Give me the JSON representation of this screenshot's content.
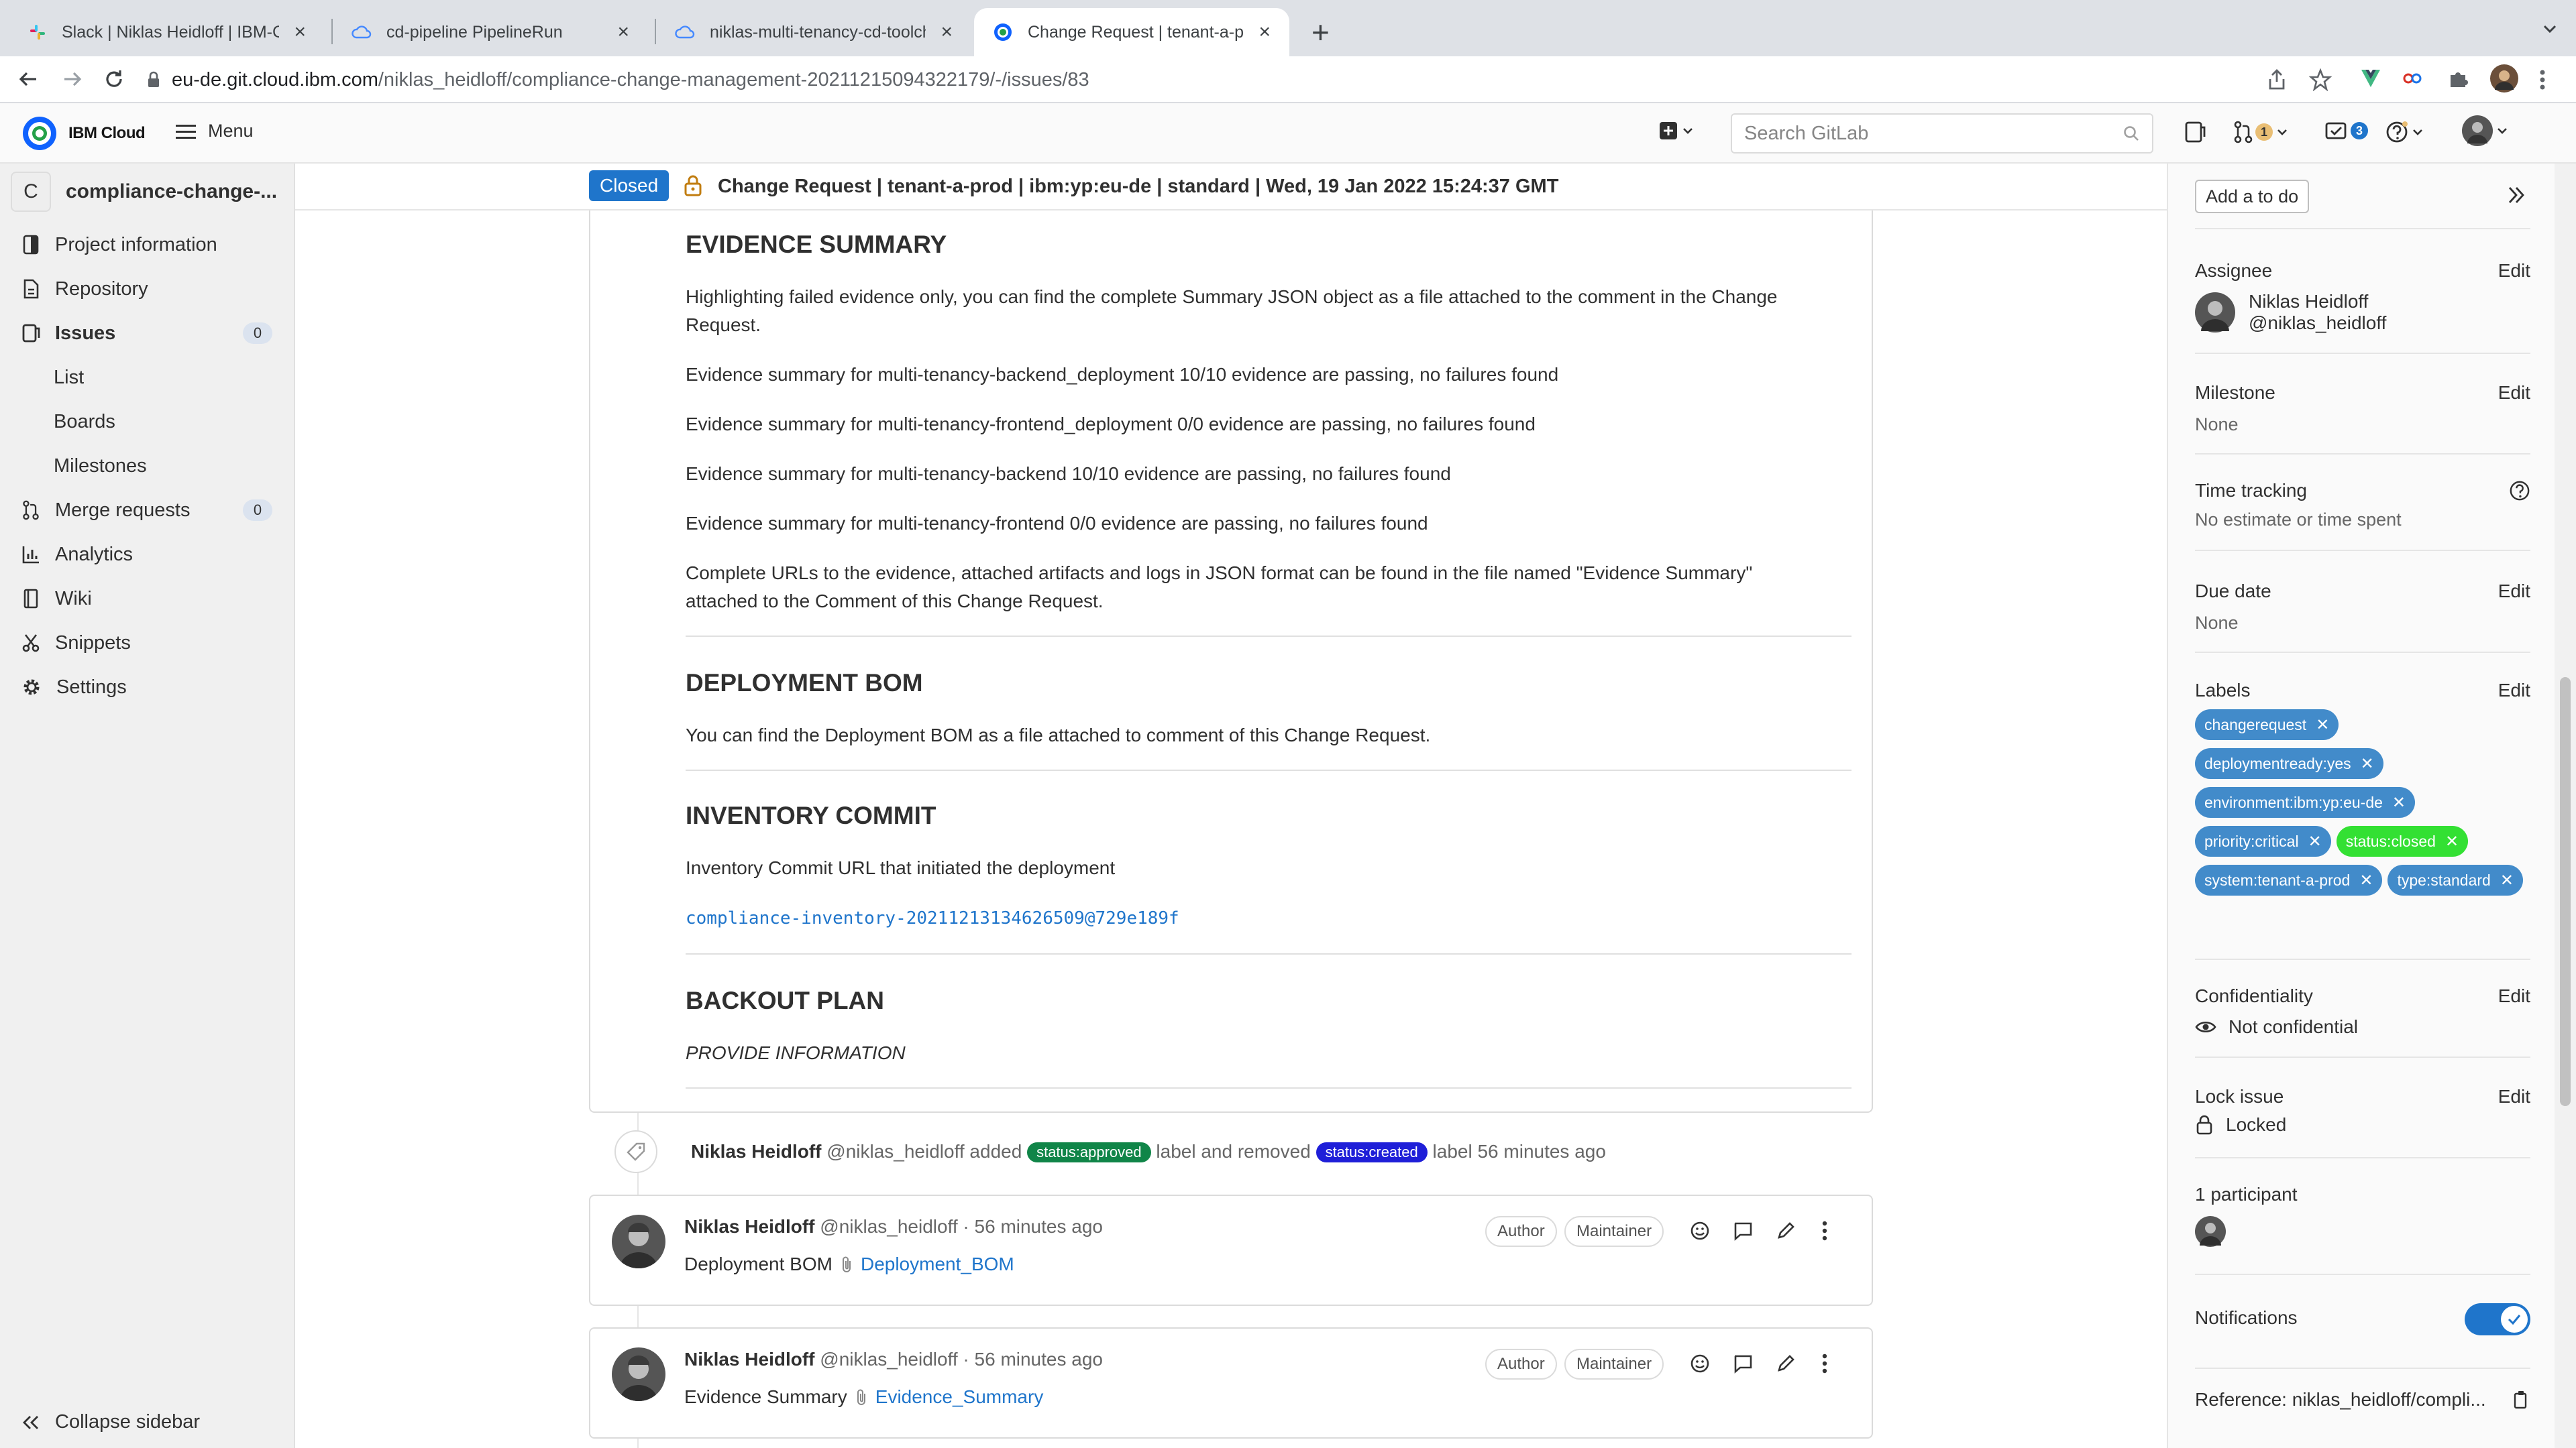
{
  "browser": {
    "tabs": [
      {
        "title": "Slack | Niklas Heidloff | IBM-Co",
        "icon": "slack-icon",
        "active": false
      },
      {
        "title": "cd-pipeline PipelineRun",
        "icon": "cloud-icon",
        "active": false
      },
      {
        "title": "niklas-multi-tenancy-cd-toolch",
        "icon": "cloud-icon",
        "active": false
      },
      {
        "title": "Change Request | tenant-a-pro",
        "icon": "gitlab-icon",
        "active": true
      }
    ],
    "url_host": "eu-de.git.cloud.ibm.com",
    "url_path": "/niklas_heidloff/compliance-change-management-20211215094322179/-/issues/83"
  },
  "topnav": {
    "brand": "IBM Cloud",
    "menu_label": "Menu",
    "search_placeholder": "Search GitLab",
    "merge_requests_count": "1",
    "todos_count": "3"
  },
  "sidebar": {
    "project_initial": "C",
    "project_name": "compliance-change-...",
    "items": [
      {
        "label": "Project information",
        "icon": "info-icon"
      },
      {
        "label": "Repository",
        "icon": "file-icon"
      },
      {
        "label": "Issues",
        "icon": "issues-icon",
        "count": "0"
      },
      {
        "label": "List"
      },
      {
        "label": "Boards"
      },
      {
        "label": "Milestones"
      },
      {
        "label": "Merge requests",
        "icon": "merge-request-icon",
        "count": "0"
      },
      {
        "label": "Analytics",
        "icon": "chart-icon"
      },
      {
        "label": "Wiki",
        "icon": "book-icon"
      },
      {
        "label": "Snippets",
        "icon": "scissors-icon"
      },
      {
        "label": "Settings",
        "icon": "gear-icon"
      }
    ],
    "collapse_label": "Collapse sidebar"
  },
  "issue": {
    "status": "Closed",
    "title": "Change Request | tenant-a-prod | ibm:yp:eu-de | standard | Wed, 19 Jan 2022 15:24:37 GMT"
  },
  "description": {
    "evidence_heading": "EVIDENCE SUMMARY",
    "evidence_intro_1": "Highlighting failed evidence only, you can find the complete Summary JSON object as a file attached to the comment in the Change",
    "evidence_intro_2": "Request.",
    "evidence_lines": [
      "Evidence summary for multi-tenancy-backend_deployment 10/10 evidence are passing, no failures found",
      "Evidence summary for multi-tenancy-frontend_deployment 0/0 evidence are passing, no failures found",
      "Evidence summary for multi-tenancy-backend 10/10 evidence are passing, no failures found",
      "Evidence summary for multi-tenancy-frontend 0/0 evidence are passing, no failures found"
    ],
    "complete_urls_1": "Complete URLs to the evidence, attached artifacts and logs in JSON format can be found in the file named \"Evidence Summary\"",
    "complete_urls_2": "attached to the Comment of this Change Request.",
    "bom_heading": "DEPLOYMENT BOM",
    "bom_text": "You can find the Deployment BOM as a file attached to comment of this Change Request.",
    "inventory_heading": "INVENTORY COMMIT",
    "inventory_text": "Inventory Commit URL that initiated the deployment",
    "inventory_link": "compliance-inventory-20211213134626509@729e189f",
    "backout_heading": "BACKOUT PLAN",
    "backout_text": "PROVIDE INFORMATION"
  },
  "activity": {
    "system_note": {
      "author": "Niklas Heidloff",
      "handle": "@niklas_heidloff",
      "added": "added",
      "label_added": "status:approved",
      "middle": "label and removed",
      "label_removed": "status:created",
      "suffix": "label 56 minutes ago"
    },
    "comments": [
      {
        "author": "Niklas Heidloff",
        "meta": "@niklas_heidloff · 56 minutes ago",
        "text": "Deployment BOM",
        "link": "Deployment_BOM",
        "badge_author": "Author",
        "badge_role": "Maintainer"
      },
      {
        "author": "Niklas Heidloff",
        "meta": "@niklas_heidloff · 56 minutes ago",
        "text": "Evidence Summary",
        "link": "Evidence_Summary",
        "badge_author": "Author",
        "badge_role": "Maintainer"
      }
    ]
  },
  "right_sidebar": {
    "add_todo": "Add a to do",
    "assignee_title": "Assignee",
    "assignee_name": "Niklas Heidloff",
    "assignee_handle": "@niklas_heidloff",
    "milestone_title": "Milestone",
    "milestone_value": "None",
    "time_title": "Time tracking",
    "time_value": "No estimate or time spent",
    "due_title": "Due date",
    "due_value": "None",
    "labels_title": "Labels",
    "labels": [
      {
        "name": "changerequest",
        "color": "#428bca"
      },
      {
        "name": "deploymentready:yes",
        "color": "#428bca"
      },
      {
        "name": "environment:ibm:yp:eu-de",
        "color": "#428bca"
      },
      {
        "name": "priority:critical",
        "color": "#428bca"
      },
      {
        "name": "status:closed",
        "color": "#33e033"
      },
      {
        "name": "system:tenant-a-prod",
        "color": "#428bca"
      },
      {
        "name": "type:standard",
        "color": "#428bca"
      }
    ],
    "confidentiality_title": "Confidentiality",
    "confidentiality_value": "Not confidential",
    "lock_title": "Lock issue",
    "lock_value": "Locked",
    "participants_title": "1 participant",
    "notifications_title": "Notifications",
    "notifications_enabled": true,
    "reference": "Reference: niklas_heidloff/compli...",
    "edit_label": "Edit"
  },
  "colors": {
    "closed_blue": "#1f75cb",
    "approved_green": "#108548",
    "created_blue": "#1f1fd8",
    "label_blue": "#428bca",
    "status_closed_green": "#33e033"
  }
}
